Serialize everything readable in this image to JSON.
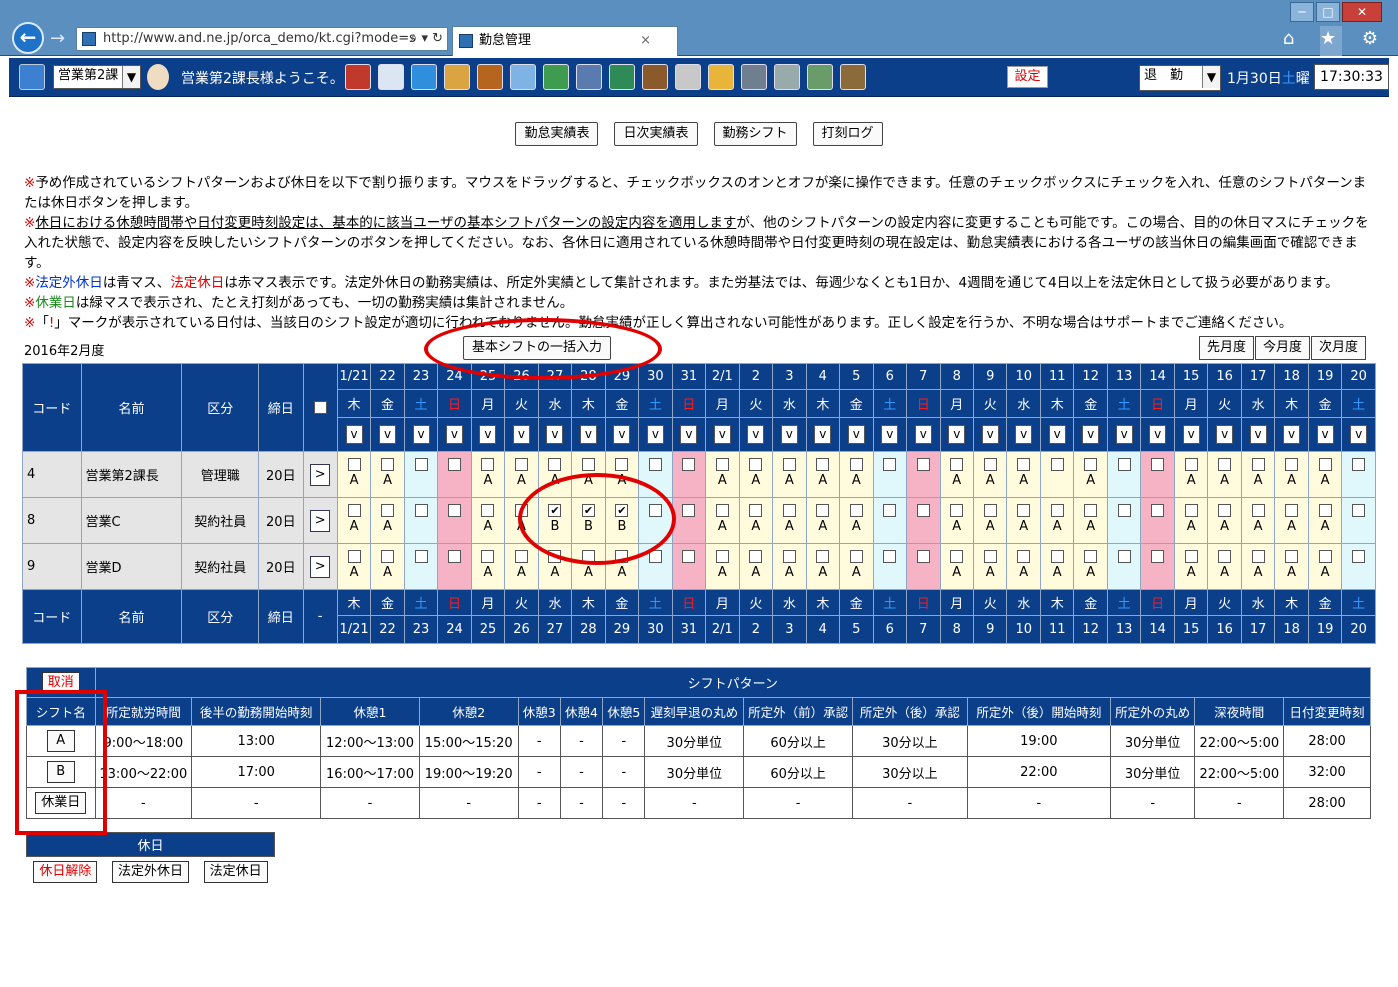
{
  "browser": {
    "url": "http://www.and.ne.jp/orca_demo/kt.cgi?mode=s",
    "tab_title": "勤怠管理",
    "win_min": "─",
    "win_max": "□",
    "win_close": "✕",
    "back": "←",
    "forward": "→",
    "addr_ctl": "⌕ ▾ ↻",
    "tab_close": "×",
    "icons": "⌂ ★ ⚙"
  },
  "appbar": {
    "dept": "営業第2課",
    "welcome": "営業第2課長様ようこそ。",
    "settings": "設定",
    "status": "退　勤",
    "date_main": "1月30日",
    "date_dow": "土",
    "date_suffix": "曜",
    "time": "17:30:33",
    "tool_icons": [
      "home-icon",
      "mail-icon",
      "globe-icon",
      "image-icon",
      "stamp-icon",
      "calendar-icon",
      "grid-icon",
      "calculator-icon",
      "book-icon",
      "gavel-icon",
      "database-icon",
      "folder-icon",
      "server-icon",
      "pen-icon",
      "user-settings-icon",
      "exit-icon"
    ]
  },
  "top_buttons": [
    "勤怠実績表",
    "日次実績表",
    "勤務シフト",
    "打刻ログ"
  ],
  "notes": {
    "n1": "予め作成されているシフトパターンおよび休日を以下で割り振ります。マウスをドラッグすると、チェックボックスのオンとオフが楽に操作できます。任意のチェックボックスにチェックを入れ、任意のシフトパターンまたは休日ボタンを押します。",
    "n2a": "休日における休憩時間帯や日付変更時刻設定は、基本的に該当ユーザの基本シフトパターンの設定内容を適用します",
    "n2b": "が、他のシフトパターンの設定内容に変更することも可能です。この場合、目的の休日マスにチェックを入れた状態で、設定内容を反映したいシフトパターンのボタンを押してください。なお、各休日に適用されている休憩時間帯や日付変更時刻の現在設定は、勤怠実績表における各ユーザの該当休日の編集画面で確認できます。",
    "n3a": "法定外休日",
    "n3b": "は青マス、",
    "n3c": "法定休日",
    "n3d": "は赤マス表示です。法定外休日の勤務実績は、所定外実績として集計されます。また労基法では、毎週少なくとも1日か、4週間を通じて4日以上を法定休日として扱う必要があります。",
    "n4a": "休業日",
    "n4b": "は緑マスで表示され、たとえ打刻があっても、一切の勤務実績は集計されません。",
    "n5a": "「",
    "n5b": "!",
    "n5c": "」マークが表示されている日付は、当該日のシフト設定が適切に行われておりません。勤怠実績が正しく算出されない可能性があります。正しく設定を行うか、不明な場合はサポートまでご連絡ください。",
    "mark": "※"
  },
  "month_label": "2016年2月度",
  "bulk_button": "基本シフトの一括入力",
  "nav": [
    "先月度",
    "今月度",
    "次月度"
  ],
  "grid": {
    "h_code": "コード",
    "h_name": "名前",
    "h_kubun": "区分",
    "h_close": "締日",
    "h_dash": "-",
    "dates": [
      "1/21",
      "22",
      "23",
      "24",
      "25",
      "26",
      "27",
      "28",
      "29",
      "30",
      "31",
      "2/1",
      "2",
      "3",
      "4",
      "5",
      "6",
      "7",
      "8",
      "9",
      "10",
      "11",
      "12",
      "13",
      "14",
      "15",
      "16",
      "17",
      "18",
      "19",
      "20"
    ],
    "dows": [
      "木",
      "金",
      "土",
      "日",
      "月",
      "火",
      "水",
      "木",
      "金",
      "土",
      "日",
      "月",
      "火",
      "水",
      "木",
      "金",
      "土",
      "日",
      "月",
      "火",
      "水",
      "木",
      "金",
      "土",
      "日",
      "月",
      "火",
      "水",
      "木",
      "金",
      "土"
    ],
    "day_types": [
      "y",
      "y",
      "b",
      "p",
      "y",
      "y",
      "y",
      "y",
      "y",
      "b",
      "p",
      "y",
      "y",
      "y",
      "y",
      "y",
      "b",
      "p",
      "y",
      "y",
      "y",
      "y",
      "y",
      "b",
      "p",
      "y",
      "y",
      "y",
      "y",
      "y",
      "b"
    ],
    "select_v": "v",
    "row_btn": ">",
    "rows": [
      {
        "code": "4",
        "name": "営業第2課長",
        "kubun": "管理職",
        "close": "20日",
        "checked": [],
        "labels": [
          "A",
          "A",
          "",
          "",
          "A",
          "A",
          "A",
          "A",
          "A",
          "",
          "",
          "A",
          "A",
          "A",
          "A",
          "A",
          "",
          "",
          "A",
          "A",
          "A",
          "",
          "A",
          "",
          "",
          "A",
          "A",
          "A",
          "A",
          "A",
          ""
        ]
      },
      {
        "code": "8",
        "name": "営業C",
        "kubun": "契約社員",
        "close": "20日",
        "checked": [
          6,
          7,
          8
        ],
        "labels": [
          "A",
          "A",
          "",
          "",
          "A",
          "A",
          "B",
          "B",
          "B",
          "",
          "",
          "A",
          "A",
          "A",
          "A",
          "A",
          "",
          "",
          "A",
          "A",
          "A",
          "A",
          "A",
          "",
          "",
          "A",
          "A",
          "A",
          "A",
          "A",
          ""
        ]
      },
      {
        "code": "9",
        "name": "営業D",
        "kubun": "契約社員",
        "close": "20日",
        "checked": [],
        "labels": [
          "A",
          "A",
          "",
          "",
          "A",
          "A",
          "A",
          "A",
          "A",
          "",
          "",
          "A",
          "A",
          "A",
          "A",
          "A",
          "",
          "",
          "A",
          "A",
          "A",
          "A",
          "A",
          "",
          "",
          "A",
          "A",
          "A",
          "A",
          "A",
          ""
        ]
      }
    ]
  },
  "pattern": {
    "cancel": "取消",
    "title": "シフトパターン",
    "headers": [
      "シフト名",
      "所定就労時間",
      "後半の勤務開始時刻",
      "休憩1",
      "休憩2",
      "休憩3",
      "休憩4",
      "休憩5",
      "遅刻早退の丸め",
      "所定外（前）承認",
      "所定外（後）承認",
      "所定外（後）開始時刻",
      "所定外の丸め",
      "深夜時間",
      "日付変更時刻"
    ],
    "rows": [
      [
        "A",
        "9:00～18:00",
        "13:00",
        "12:00～13:00",
        "15:00～15:20",
        "-",
        "-",
        "-",
        "30分単位",
        "60分以上",
        "30分以上",
        "19:00",
        "30分単位",
        "22:00～5:00",
        "28:00"
      ],
      [
        "B",
        "13:00～22:00",
        "17:00",
        "16:00～17:00",
        "19:00～19:20",
        "-",
        "-",
        "-",
        "30分単位",
        "60分以上",
        "30分以上",
        "22:00",
        "30分単位",
        "22:00～5:00",
        "32:00"
      ],
      [
        "休業日",
        "-",
        "-",
        "-",
        "-",
        "-",
        "-",
        "-",
        "-",
        "-",
        "-",
        "-",
        "-",
        "-",
        "28:00"
      ]
    ]
  },
  "holiday": {
    "title": "休日",
    "buttons": [
      "休日解除",
      "法定外休日",
      "法定休日"
    ]
  },
  "colors": {
    "header_blue": "#0c3f8a",
    "weekday": "#fffbdc",
    "non_legal_holiday": "#e0f7fb",
    "legal_holiday": "#f6b3c6",
    "annotation_red": "#e00000"
  }
}
